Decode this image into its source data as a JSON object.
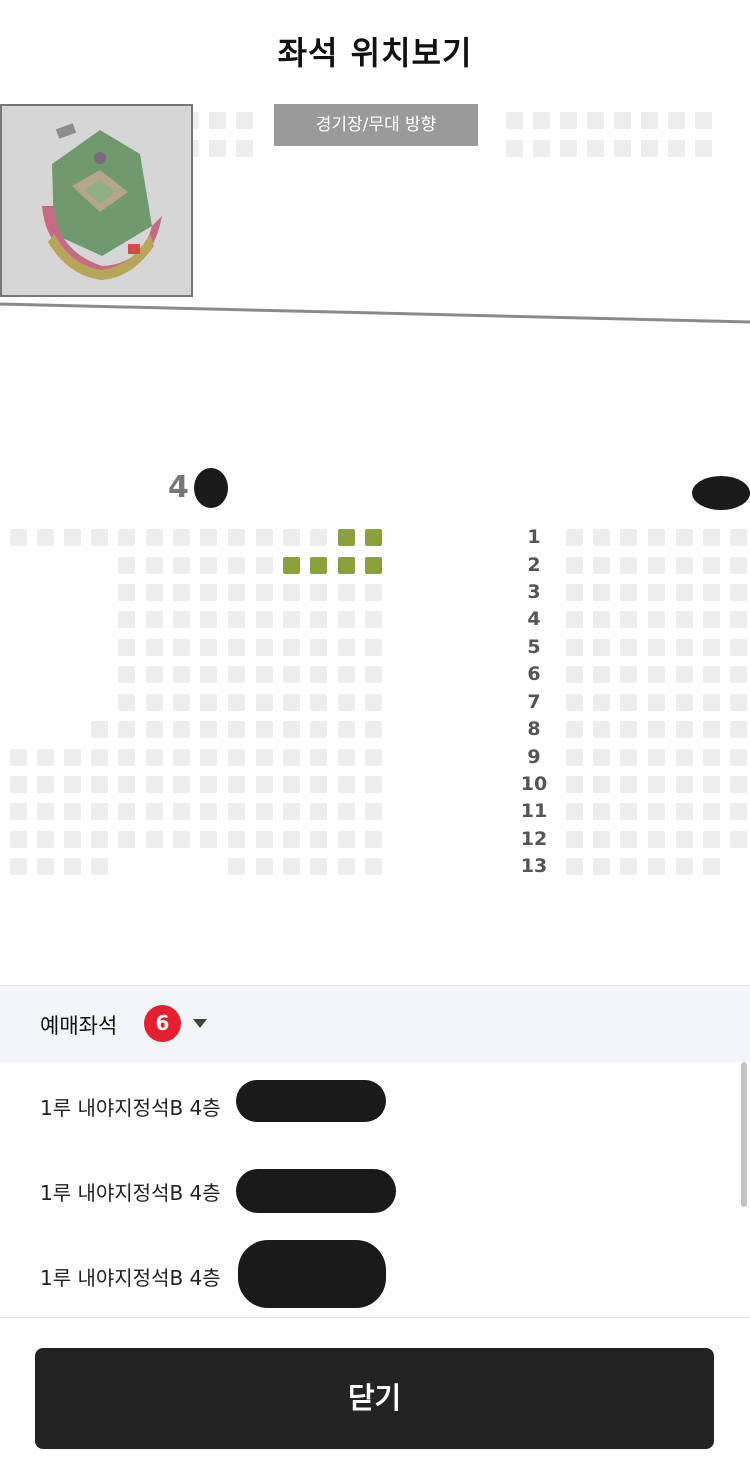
{
  "header": {
    "title": "좌석 위치보기"
  },
  "seatmap": {
    "stage_label": "경기장/무대 방향",
    "section_left_label": "4",
    "row_numbers": [
      "1",
      "2",
      "3",
      "4",
      "5",
      "6",
      "7",
      "8",
      "9",
      "10",
      "11",
      "12",
      "13"
    ],
    "colors": {
      "available": "#ededed",
      "selected": "#8aa13c",
      "stage": "#9a9a9a"
    }
  },
  "panel": {
    "label": "예매좌석",
    "count": "6",
    "expand_icon": "caret-down-icon",
    "items": [
      {
        "text": "1루 내야지정석B 4층"
      },
      {
        "text": "1루 내야지정석B 4층"
      },
      {
        "text": "1루 내야지정석B 4층"
      }
    ]
  },
  "footer": {
    "close_label": "닫기"
  }
}
